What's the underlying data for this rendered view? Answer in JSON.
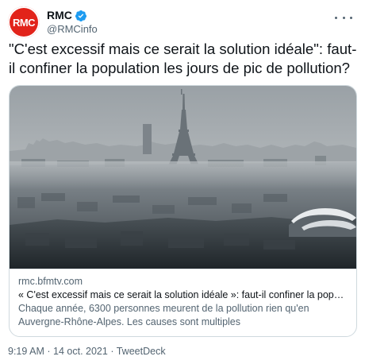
{
  "author": {
    "avatar_text": "RMC",
    "display_name": "RMC",
    "handle": "@RMCinfo",
    "verified_icon": "verified-badge-icon",
    "brand_color": "#e2231a",
    "verified_color": "#1d9bf0"
  },
  "tweet": {
    "text": "\"C'est excessif mais ce serait la solution idéale\": faut-il confiner la population les jours de pic de pollution?"
  },
  "card": {
    "image_icon": "eiffel-tower-smog-photo",
    "domain": "rmc.bfmtv.com",
    "title": "« C'est excessif mais ce serait la solution idéale »: faut-il confiner la population…",
    "description": "Chaque année, 6300 personnes meurent de la pollution rien qu'en Auvergne-Rhône-Alpes. Les causes sont multiples"
  },
  "meta": {
    "time": "9:19 AM",
    "separator": "·",
    "date": "14 oct. 2021",
    "source": "TweetDeck"
  }
}
